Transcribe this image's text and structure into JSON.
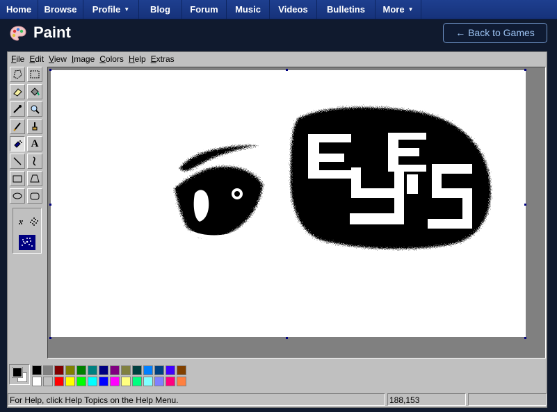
{
  "nav": {
    "items": [
      {
        "label": "Home",
        "dropdown": false
      },
      {
        "label": "Browse",
        "dropdown": false
      },
      {
        "label": "Profile",
        "dropdown": true
      },
      {
        "label": "Blog",
        "dropdown": false
      },
      {
        "label": "Forum",
        "dropdown": false
      },
      {
        "label": "Music",
        "dropdown": false
      },
      {
        "label": "Videos",
        "dropdown": false
      },
      {
        "label": "Bulletins",
        "dropdown": false
      },
      {
        "label": "More",
        "dropdown": true
      }
    ]
  },
  "header": {
    "title": "Paint",
    "icon": "palette-icon",
    "back_label": "← Back to Games"
  },
  "menu": [
    "File",
    "Edit",
    "View",
    "Image",
    "Colors",
    "Help",
    "Extras"
  ],
  "tools": [
    "free-select-icon",
    "rect-select-icon",
    "eraser-icon",
    "fill-bucket-icon",
    "color-picker-icon",
    "magnifier-icon",
    "pencil-icon",
    "brush-icon",
    "airbrush-icon",
    "text-icon",
    "line-icon",
    "curve-icon",
    "rectangle-icon",
    "polygon-icon",
    "ellipse-icon",
    "rounded-rect-icon"
  ],
  "selected_tool": "airbrush-icon",
  "text_tool_glyph": "A",
  "colors": {
    "foreground": "#000000",
    "background": "#ffffff",
    "palette_top": [
      "#000000",
      "#808080",
      "#800000",
      "#808000",
      "#008000",
      "#008080",
      "#000080",
      "#800080",
      "#808040",
      "#004040",
      "#0080ff",
      "#004080",
      "#4000ff",
      "#804000"
    ],
    "palette_bottom": [
      "#ffffff",
      "#c0c0c0",
      "#ff0000",
      "#ffff00",
      "#00ff00",
      "#00ffff",
      "#0000ff",
      "#ff00ff",
      "#ffff80",
      "#00ff80",
      "#80ffff",
      "#8080ff",
      "#ff0080",
      "#ff8040"
    ]
  },
  "status": {
    "help_text": "For Help, click Help Topics on the Help Menu.",
    "coords": "188,153",
    "extra": ""
  }
}
